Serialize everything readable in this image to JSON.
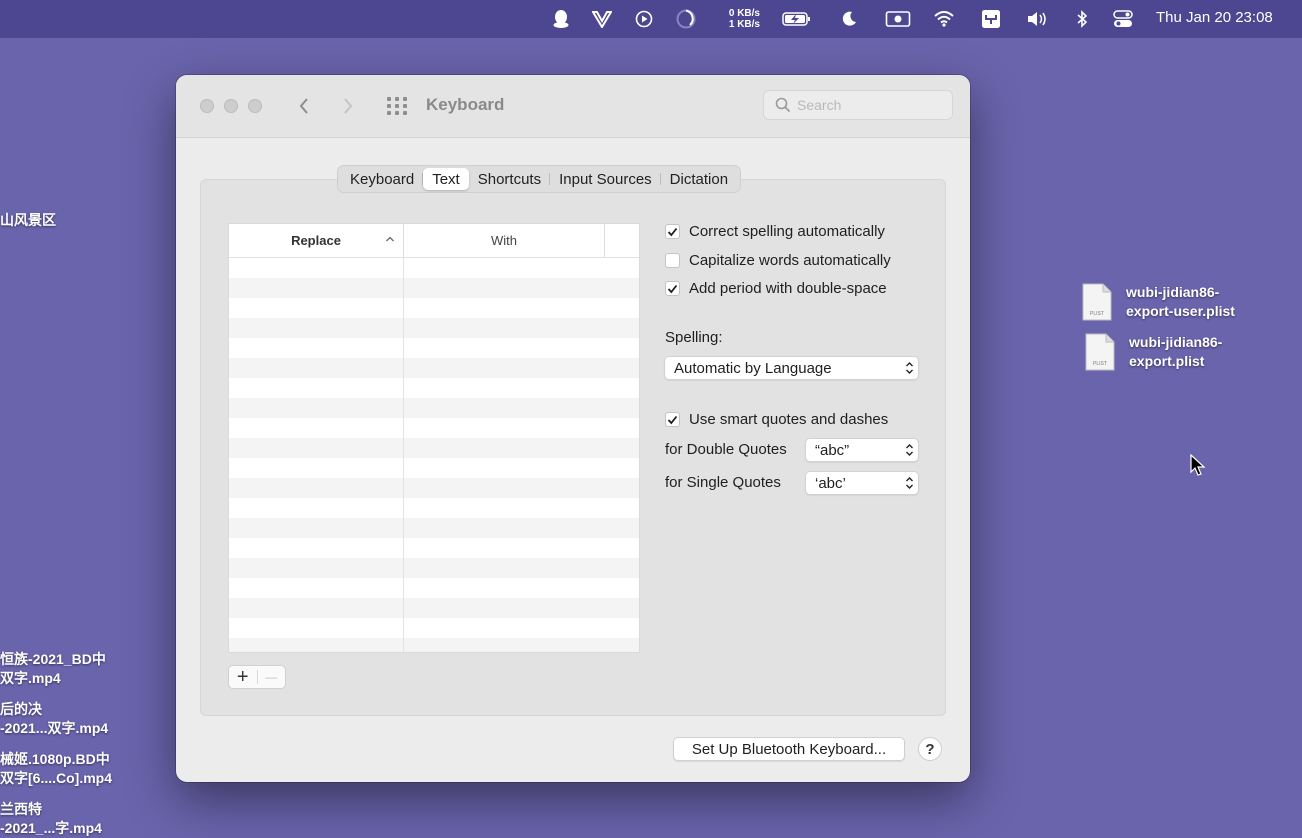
{
  "menubar": {
    "icons": [
      "qq-icon",
      "v-logo-icon",
      "play-circle-icon",
      "activity-ring-icon",
      "battery-icon",
      "moon-icon",
      "screen-record-icon",
      "wifi-icon",
      "input-method-icon",
      "volume-icon",
      "bluetooth-icon",
      "control-center-icon"
    ],
    "net_up": "0 KB/s",
    "net_down": "1 KB/s",
    "clock": "Thu Jan 20  23:08"
  },
  "desktop": {
    "files": [
      {
        "line1": "wubi-jidian86-",
        "line2": "export-user.plist",
        "icon_tag": "PLIST"
      },
      {
        "line1": "wubi-jidian86-",
        "line2": "export.plist",
        "icon_tag": "PLIST"
      }
    ],
    "left_items": [
      {
        "line1": "山风景区",
        "line2": ""
      },
      {
        "line1": "恒族-2021_BD中",
        "line2": "双字.mp4"
      },
      {
        "line1": "后的决",
        "line2": "-2021...双字.mp4"
      },
      {
        "line1": "械姬.1080p.BD中",
        "line2": "双字[6....Co].mp4"
      },
      {
        "line1": "兰西特",
        "line2": "-2021_...字.mp4"
      }
    ]
  },
  "window": {
    "title": "Keyboard",
    "search_placeholder": "Search",
    "tabs": [
      {
        "label": "Keyboard",
        "active": false
      },
      {
        "label": "Text",
        "active": true
      },
      {
        "label": "Shortcuts",
        "active": false
      },
      {
        "label": "Input Sources",
        "active": false
      },
      {
        "label": "Dictation",
        "active": false
      }
    ],
    "table": {
      "col_replace": "Replace",
      "col_with": "With",
      "rows": []
    },
    "options": {
      "correct_spelling": {
        "label": "Correct spelling automatically",
        "checked": true
      },
      "capitalize": {
        "label": "Capitalize words automatically",
        "checked": false
      },
      "add_period": {
        "label": "Add period with double-space",
        "checked": true
      },
      "spelling_label": "Spelling:",
      "spelling_value": "Automatic by Language",
      "smart_quotes": {
        "label": "Use smart quotes and dashes",
        "checked": true
      },
      "double_quotes_label": "for Double Quotes",
      "double_quotes_value": "“abc”",
      "single_quotes_label": "for Single Quotes",
      "single_quotes_value": "‘abc’"
    },
    "add_label": "+",
    "remove_label": "—",
    "bluetooth_button": "Set Up Bluetooth Keyboard...",
    "help_label": "?"
  }
}
